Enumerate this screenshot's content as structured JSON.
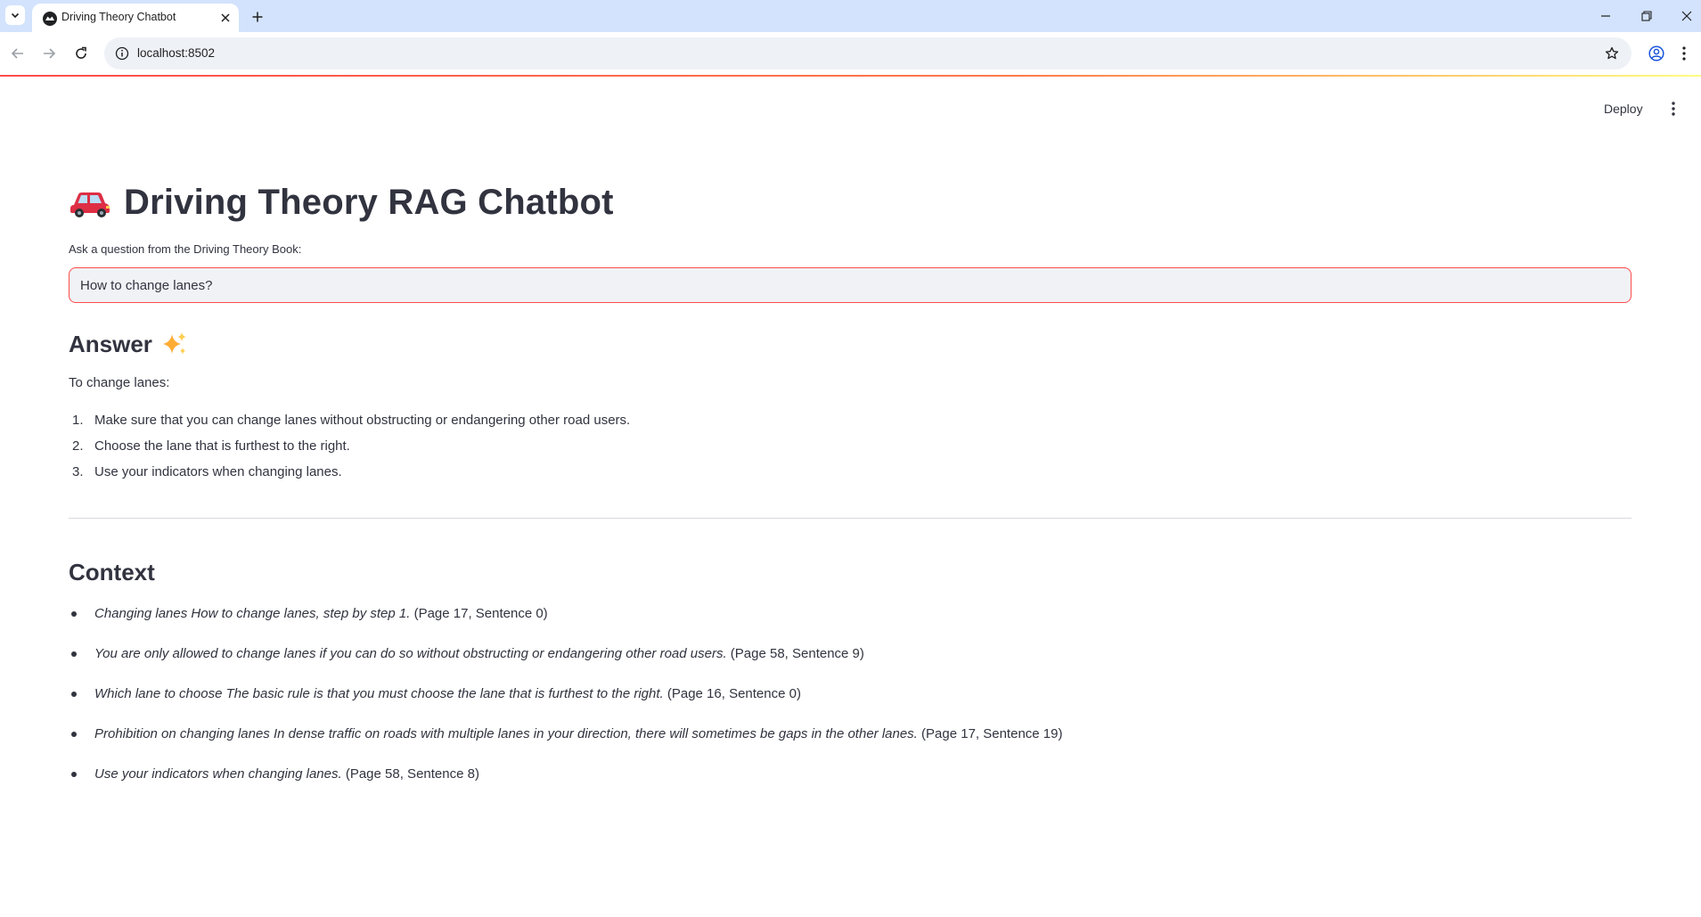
{
  "browser": {
    "tab_title": "Driving Theory Chatbot",
    "url": "localhost:8502"
  },
  "app": {
    "deploy_label": "Deploy",
    "title": "Driving Theory RAG Chatbot",
    "title_icon": "car-icon",
    "input_label": "Ask a question from the Driving Theory Book:",
    "input_value": "How to change lanes?",
    "answer_heading": "Answer",
    "answer_icon": "sparkles-icon",
    "answer_intro": "To change lanes:",
    "answer_steps": [
      {
        "num": "1.",
        "text": "Make sure that you can change lanes without obstructing or endangering other road users."
      },
      {
        "num": "2.",
        "text": "Choose the lane that is furthest to the right."
      },
      {
        "num": "3.",
        "text": "Use your indicators when changing lanes."
      }
    ],
    "context_heading": "Context",
    "context_items": [
      {
        "quote": "Changing lanes How to change lanes, step by step 1.",
        "source": "(Page 17, Sentence 0)"
      },
      {
        "quote": "You are only allowed to change lanes if you can do so without obstructing or endangering other road users.",
        "source": "(Page 58, Sentence 9)"
      },
      {
        "quote": "Which lane to choose The basic rule is that you must choose the lane that is furthest to the right.",
        "source": "(Page 16, Sentence 0)"
      },
      {
        "quote": "Prohibition on changing lanes In dense traffic on roads with multiple lanes in your direction, there will sometimes be gaps in the other lanes.",
        "source": "(Page 17, Sentence 19)"
      },
      {
        "quote": "Use your indicators when changing lanes.",
        "source": "(Page 58, Sentence 8)"
      }
    ],
    "accent_color": "#ff4b4b"
  }
}
